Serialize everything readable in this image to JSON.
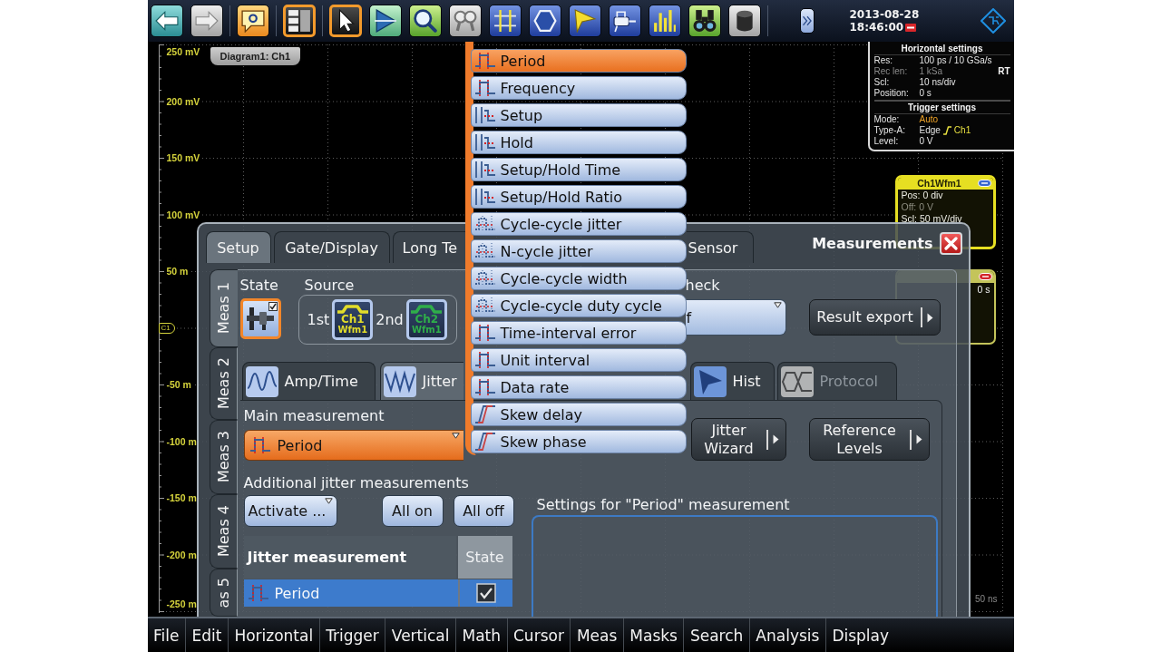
{
  "toolbar": {
    "groups": [
      [
        {
          "kind": "undo",
          "selected": false,
          "disabled": false
        },
        {
          "kind": "redo",
          "selected": false,
          "disabled": true
        }
      ],
      [
        {
          "kind": "help",
          "selected": false,
          "disabled": false
        }
      ],
      [
        {
          "kind": "layout",
          "selected": true,
          "disabled": false
        }
      ],
      [
        {
          "kind": "pointer",
          "selected": true,
          "disabled": false
        },
        {
          "kind": "trigger",
          "selected": false,
          "disabled": false
        },
        {
          "kind": "zoom",
          "selected": false,
          "disabled": false
        },
        {
          "kind": "coupled-zoom",
          "selected": false,
          "disabled": true
        },
        {
          "kind": "cursor",
          "selected": false,
          "disabled": false
        },
        {
          "kind": "mask",
          "selected": false,
          "disabled": false
        },
        {
          "kind": "histogram",
          "selected": false,
          "disabled": false
        },
        {
          "kind": "probe",
          "selected": false,
          "disabled": false
        },
        {
          "kind": "fft",
          "selected": false,
          "disabled": false
        },
        {
          "kind": "search",
          "selected": false,
          "disabled": false
        },
        {
          "kind": "clear",
          "selected": false,
          "disabled": false
        }
      ],
      [
        {
          "kind": "toggle",
          "selected": false,
          "disabled": false
        }
      ]
    ],
    "date": "2013-08-28",
    "time": "18:46:00"
  },
  "diagram": {
    "tab": "Diagram1: Ch1",
    "y_axis": [
      {
        "kind": "label",
        "text": "250 mV"
      },
      {
        "kind": "label",
        "text": "200 mV"
      },
      {
        "kind": "label",
        "text": "150 mV"
      },
      {
        "kind": "label",
        "text": "100 mV"
      },
      {
        "kind": "label",
        "text": "50 m"
      },
      {
        "kind": "marker",
        "text": "C1"
      },
      {
        "kind": "label",
        "text": "-50 m"
      },
      {
        "kind": "label",
        "text": "-100 m"
      },
      {
        "kind": "label",
        "text": "-150 m"
      },
      {
        "kind": "label",
        "text": "-200 m"
      },
      {
        "kind": "label",
        "text": "-250 m"
      }
    ],
    "x_end": "50 ns"
  },
  "horizontal_settings": {
    "title": "Horizontal settings",
    "rows": [
      {
        "label": "Res:",
        "value": "100 ps / 10 GSa/s",
        "dimmed": false
      },
      {
        "label": "Rec len:",
        "value": "1 kSa",
        "mode": "RT",
        "dimmed": true
      },
      {
        "label": "Scl:",
        "value": "10 ns/div",
        "dimmed": false
      },
      {
        "label": "Position:",
        "value": "0 s",
        "dimmed": false
      }
    ]
  },
  "trigger_settings": {
    "title": "Trigger settings",
    "rows": [
      {
        "label": "Mode:",
        "value": "Auto",
        "kind": "highlight"
      },
      {
        "label": "Type-A:",
        "value": "Edge",
        "kind": "edge",
        "source": "Ch1"
      },
      {
        "label": "Level:",
        "value": "0 V",
        "kind": "plain"
      }
    ]
  },
  "waveform_box": {
    "title": "Ch1Wfm1",
    "rows": [
      {
        "text": "Pos: 0 div",
        "dimmed": false
      },
      {
        "text": "Off: 0 V",
        "dimmed": true
      },
      {
        "text": "Scl: 50 mV/div",
        "dimmed": false
      }
    ]
  },
  "measurement_box": {
    "value": "0 s"
  },
  "dialog": {
    "tabs": [
      {
        "label": "Setup",
        "selected": true
      },
      {
        "label": "Gate/Display",
        "selected": false
      },
      {
        "label": "Long Te",
        "selected": false
      },
      {
        "label": "Sensor",
        "selected": false
      }
    ],
    "title": "Measurements",
    "side_tabs": [
      {
        "label": "Meas 1",
        "selected": true
      },
      {
        "label": "Meas 2",
        "selected": false
      },
      {
        "label": "Meas 3",
        "selected": false
      },
      {
        "label": "Meas 4",
        "selected": false
      },
      {
        "label": "as 5",
        "selected": false
      }
    ],
    "state": {
      "label": "State",
      "on": true
    },
    "source": {
      "label": "Source",
      "inputs": [
        {
          "label": "1st",
          "channel": "Ch1",
          "waveform": "Wfm1",
          "color": "#e2dc2a"
        },
        {
          "label": "2nd",
          "channel": "Ch2",
          "waveform": "Wfm1",
          "color": "#2fae4a"
        }
      ]
    },
    "limit_check": {
      "label": "heck",
      "value": "f"
    },
    "result_export": "Result export",
    "categories": [
      {
        "label": "Amp/Time",
        "kind": "amp-time",
        "selected": false,
        "disabled": false
      },
      {
        "label": "Jitter",
        "kind": "jitter",
        "selected": true,
        "disabled": false
      },
      {
        "label": "Hist",
        "kind": "histogram",
        "selected": false,
        "disabled": false
      },
      {
        "label": "Protocol",
        "kind": "protocol",
        "selected": false,
        "disabled": true
      }
    ],
    "main_measurement": {
      "label": "Main measurement",
      "value": "Period"
    },
    "side_buttons": [
      "Jitter Wizard",
      "Reference Levels"
    ],
    "additional": {
      "label": "Additional jitter measurements",
      "buttons": [
        {
          "label": "Activate ...",
          "kind": "menu"
        },
        {
          "label": "All on",
          "kind": "plain"
        },
        {
          "label": "All off",
          "kind": "plain"
        }
      ]
    },
    "table": {
      "columns": [
        "Jitter measurement",
        "State"
      ],
      "rows": [
        {
          "name": "Period",
          "selected": true,
          "checked": true
        }
      ]
    },
    "settings_label": "Settings for \"Period\" measurement"
  },
  "dropdown": {
    "items": [
      {
        "label": "Period",
        "kind": "pulse",
        "selected": true
      },
      {
        "label": "Frequency",
        "kind": "pulse",
        "selected": false
      },
      {
        "label": "Setup",
        "kind": "timing",
        "selected": false
      },
      {
        "label": "Hold",
        "kind": "timing",
        "selected": false
      },
      {
        "label": "Setup/Hold Time",
        "kind": "timing",
        "selected": false
      },
      {
        "label": "Setup/Hold Ratio",
        "kind": "timing",
        "selected": false
      },
      {
        "label": "Cycle-cycle jitter",
        "kind": "jitter",
        "selected": false
      },
      {
        "label": "N-cycle jitter",
        "kind": "jitter",
        "selected": false
      },
      {
        "label": "Cycle-cycle width",
        "kind": "jitter",
        "selected": false
      },
      {
        "label": "Cycle-cycle duty cycle",
        "kind": "jitter",
        "selected": false
      },
      {
        "label": "Time-interval error",
        "kind": "pulse",
        "selected": false
      },
      {
        "label": "Unit interval",
        "kind": "pulse",
        "selected": false
      },
      {
        "label": "Data rate",
        "kind": "pulse",
        "selected": false
      },
      {
        "label": "Skew delay",
        "kind": "skew",
        "selected": false
      },
      {
        "label": "Skew phase",
        "kind": "skew",
        "selected": false
      }
    ]
  },
  "menu_bar": {
    "items": [
      "File",
      "Edit",
      "Horizontal",
      "Trigger",
      "Vertical",
      "Math",
      "Cursor",
      "Meas",
      "Masks",
      "Search",
      "Analysis",
      "Display"
    ]
  }
}
